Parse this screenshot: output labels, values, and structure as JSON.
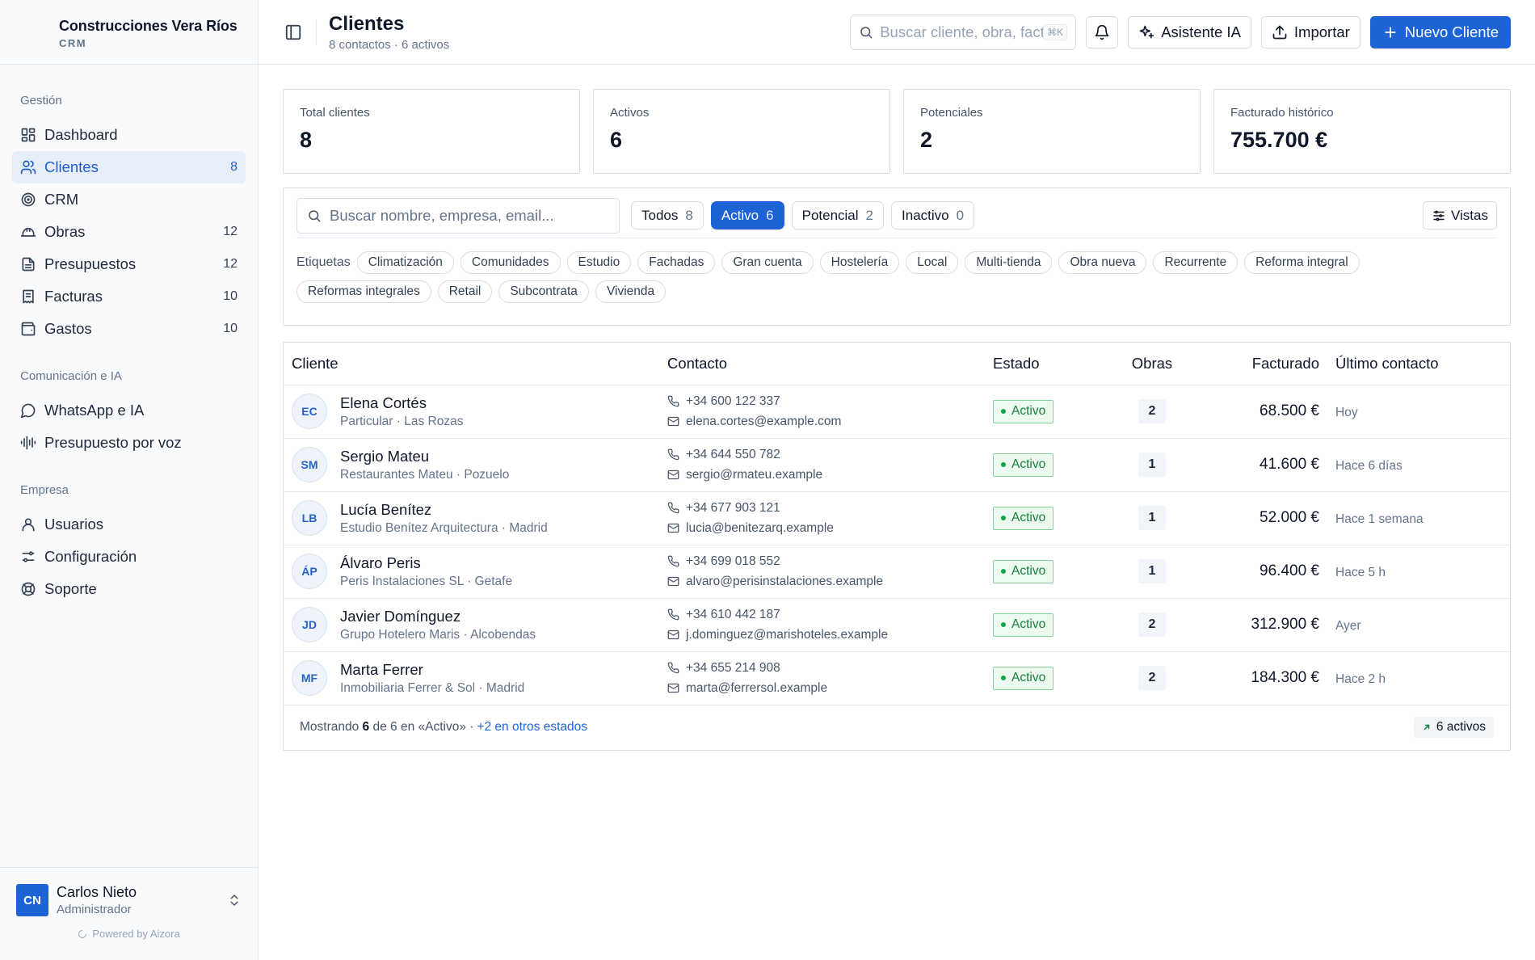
{
  "brand": {
    "name": "Construcciones Vera Ríos",
    "sub": "CRM"
  },
  "sidebar": {
    "sections": [
      {
        "title": "Gestión",
        "items": [
          {
            "label": "Dashboard",
            "icon": "dashboard-icon",
            "count": ""
          },
          {
            "label": "Clientes",
            "icon": "users-icon",
            "count": "8",
            "active": true
          },
          {
            "label": "CRM",
            "icon": "target-icon",
            "count": ""
          },
          {
            "label": "Obras",
            "icon": "helmet-icon",
            "count": "12"
          },
          {
            "label": "Presupuestos",
            "icon": "document-icon",
            "count": "12"
          },
          {
            "label": "Facturas",
            "icon": "receipt-icon",
            "count": "10"
          },
          {
            "label": "Gastos",
            "icon": "wallet-icon",
            "count": "10"
          }
        ]
      },
      {
        "title": "Comunicación e IA",
        "items": [
          {
            "label": "WhatsApp e IA",
            "icon": "chat-icon",
            "count": ""
          },
          {
            "label": "Presupuesto por voz",
            "icon": "audio-wave-icon",
            "count": ""
          }
        ]
      },
      {
        "title": "Empresa",
        "items": [
          {
            "label": "Usuarios",
            "icon": "user-icon",
            "count": ""
          },
          {
            "label": "Configuración",
            "icon": "settings-icon",
            "count": ""
          },
          {
            "label": "Soporte",
            "icon": "lifebuoy-icon",
            "count": ""
          }
        ]
      }
    ]
  },
  "user": {
    "initials": "CN",
    "name": "Carlos Nieto",
    "role": "Administrador"
  },
  "powered": "Powered by Aizora",
  "header": {
    "title": "Clientes",
    "subtitle": "8 contactos · 6 activos",
    "search_placeholder": "Buscar cliente, obra, factura...",
    "shortcut": "⌘K",
    "ai_label": "Asistente IA",
    "import_label": "Importar",
    "new_label": "Nuevo Cliente"
  },
  "stats": [
    {
      "label": "Total clientes",
      "value": "8"
    },
    {
      "label": "Activos",
      "value": "6"
    },
    {
      "label": "Potenciales",
      "value": "2"
    },
    {
      "label": "Facturado histórico",
      "value": "755.700 €"
    }
  ],
  "filters": {
    "search_placeholder": "Buscar nombre, empresa, email...",
    "chips": [
      {
        "label": "Todos",
        "count": "8",
        "active": false
      },
      {
        "label": "Activo",
        "count": "6",
        "active": true
      },
      {
        "label": "Potencial",
        "count": "2",
        "active": false
      },
      {
        "label": "Inactivo",
        "count": "0",
        "active": false
      }
    ],
    "views_label": "Vistas",
    "tags_label": "Etiquetas",
    "tags": [
      "Climatización",
      "Comunidades",
      "Estudio",
      "Fachadas",
      "Gran cuenta",
      "Hostelería",
      "Local",
      "Multi-tienda",
      "Obra nueva",
      "Recurrente",
      "Reforma integral",
      "Reformas integrales",
      "Retail",
      "Subcontrata",
      "Vivienda"
    ]
  },
  "table": {
    "columns": [
      "Cliente",
      "Contacto",
      "Estado",
      "Obras",
      "Facturado",
      "Último contacto"
    ],
    "rows": [
      {
        "initials": "EC",
        "name": "Elena Cortés",
        "sub": "Particular · Las Rozas",
        "phone": "+34 600 122 337",
        "email": "elena.cortes@example.com",
        "status": "Activo",
        "obras": "2",
        "billed": "68.500 €",
        "last": "Hoy"
      },
      {
        "initials": "SM",
        "name": "Sergio Mateu",
        "sub": "Restaurantes Mateu · Pozuelo",
        "phone": "+34 644 550 782",
        "email": "sergio@rmateu.example",
        "status": "Activo",
        "obras": "1",
        "billed": "41.600 €",
        "last": "Hace 6 días"
      },
      {
        "initials": "LB",
        "name": "Lucía Benítez",
        "sub": "Estudio Benítez Arquitectura · Madrid",
        "phone": "+34 677 903 121",
        "email": "lucia@benitezarq.example",
        "status": "Activo",
        "obras": "1",
        "billed": "52.000 €",
        "last": "Hace 1 semana"
      },
      {
        "initials": "ÁP",
        "name": "Álvaro Peris",
        "sub": "Peris Instalaciones SL · Getafe",
        "phone": "+34 699 018 552",
        "email": "alvaro@perisinstalaciones.example",
        "status": "Activo",
        "obras": "1",
        "billed": "96.400 €",
        "last": "Hace 5 h"
      },
      {
        "initials": "JD",
        "name": "Javier Domínguez",
        "sub": "Grupo Hotelero Maris · Alcobendas",
        "phone": "+34 610 442 187",
        "email": "j.dominguez@marishoteles.example",
        "status": "Activo",
        "obras": "2",
        "billed": "312.900 €",
        "last": "Ayer"
      },
      {
        "initials": "MF",
        "name": "Marta Ferrer",
        "sub": "Inmobiliaria Ferrer & Sol · Madrid",
        "phone": "+34 655 214 908",
        "email": "marta@ferrersol.example",
        "status": "Activo",
        "obras": "2",
        "billed": "184.300 €",
        "last": "Hace 2 h"
      }
    ],
    "footer": {
      "prefix": "Mostrando",
      "shown": "6",
      "middle": "de 6 en «Activo» ·",
      "link": "+2 en otros estados",
      "pill": "6 activos"
    }
  }
}
